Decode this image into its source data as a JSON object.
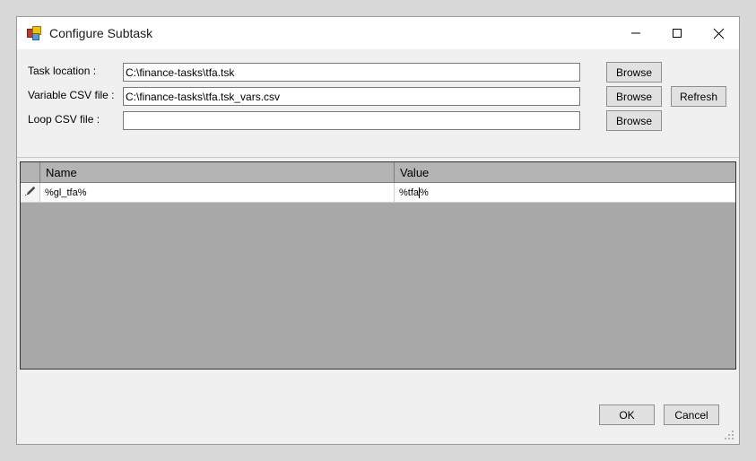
{
  "window": {
    "title": "Configure Subtask",
    "icon": "form-designer-icon",
    "controls": {
      "minimize": "minimize-icon",
      "maximize": "maximize-icon",
      "close": "close-icon"
    }
  },
  "form": {
    "fields": [
      {
        "label": "Task location :",
        "value": "C:\\finance-tasks\\tfa.tsk",
        "placeholder": "",
        "browse_label": "Browse"
      },
      {
        "label": "Variable CSV file :",
        "value": "C:\\finance-tasks\\tfa.tsk_vars.csv",
        "placeholder": "",
        "browse_label": "Browse",
        "refresh_label": "Refresh"
      },
      {
        "label": "Loop CSV file :",
        "value": "",
        "placeholder": "",
        "browse_label": "Browse"
      }
    ]
  },
  "grid": {
    "columns": [
      "",
      "Name",
      "Value"
    ],
    "rows": [
      {
        "indicator": "edit-pencil-icon",
        "name": "%gl_tfa%",
        "value_before_caret": "%tfa",
        "value_after_caret": "%"
      }
    ]
  },
  "footer": {
    "ok_label": "OK",
    "cancel_label": "Cancel",
    "resize_grip": "resize-grip-icon"
  },
  "colors": {
    "desktop": "#d8d8d8",
    "window_bg": "#f0f0f0",
    "titlebar": "#ffffff",
    "grid_empty": "#a8a8a8",
    "grid_header": "#b4b4b4",
    "button_face": "#e1e1e1"
  }
}
